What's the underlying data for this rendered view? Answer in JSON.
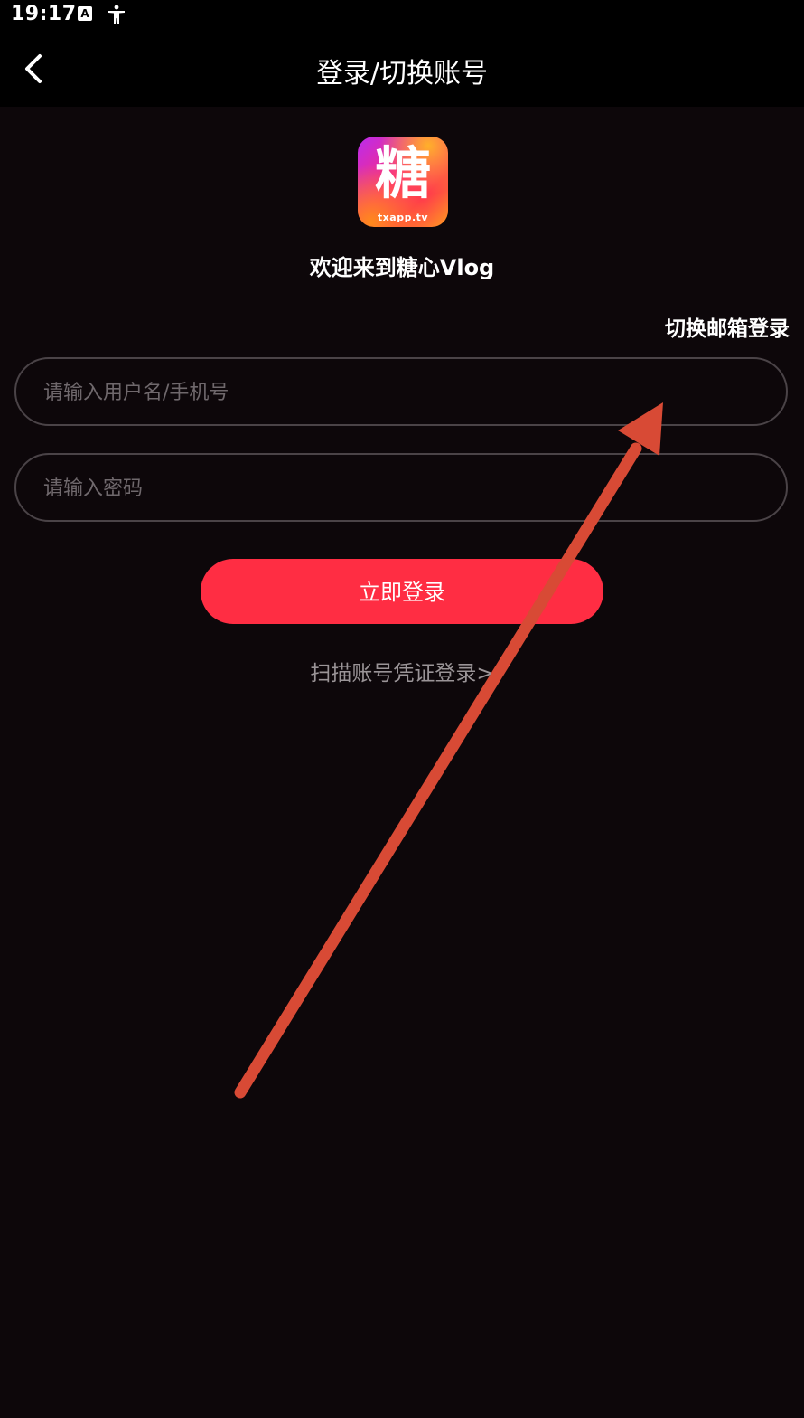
{
  "status_bar": {
    "time": "19:17",
    "notification_icon": "A",
    "accessibility_icon": "accessibility-icon"
  },
  "header": {
    "back_icon": "chevron-left-icon",
    "title": "登录/切换账号"
  },
  "logo": {
    "character": "糖",
    "subtitle": "txapp.tv",
    "colors": [
      "#b92cf0",
      "#ff2d7a",
      "#ff9a1f"
    ]
  },
  "welcome_text": "欢迎来到糖心Vlog",
  "switch_email_label": "切换邮箱登录",
  "form": {
    "username_placeholder": "请输入用户名/手机号",
    "username_value": "",
    "password_placeholder": "请输入密码",
    "password_value": ""
  },
  "login_button_label": "立即登录",
  "scan_login_label": "扫描账号凭证登录>",
  "colors": {
    "background": "#0d070a",
    "accent": "#ff2d43",
    "annotation_arrow": "#d84a35"
  }
}
